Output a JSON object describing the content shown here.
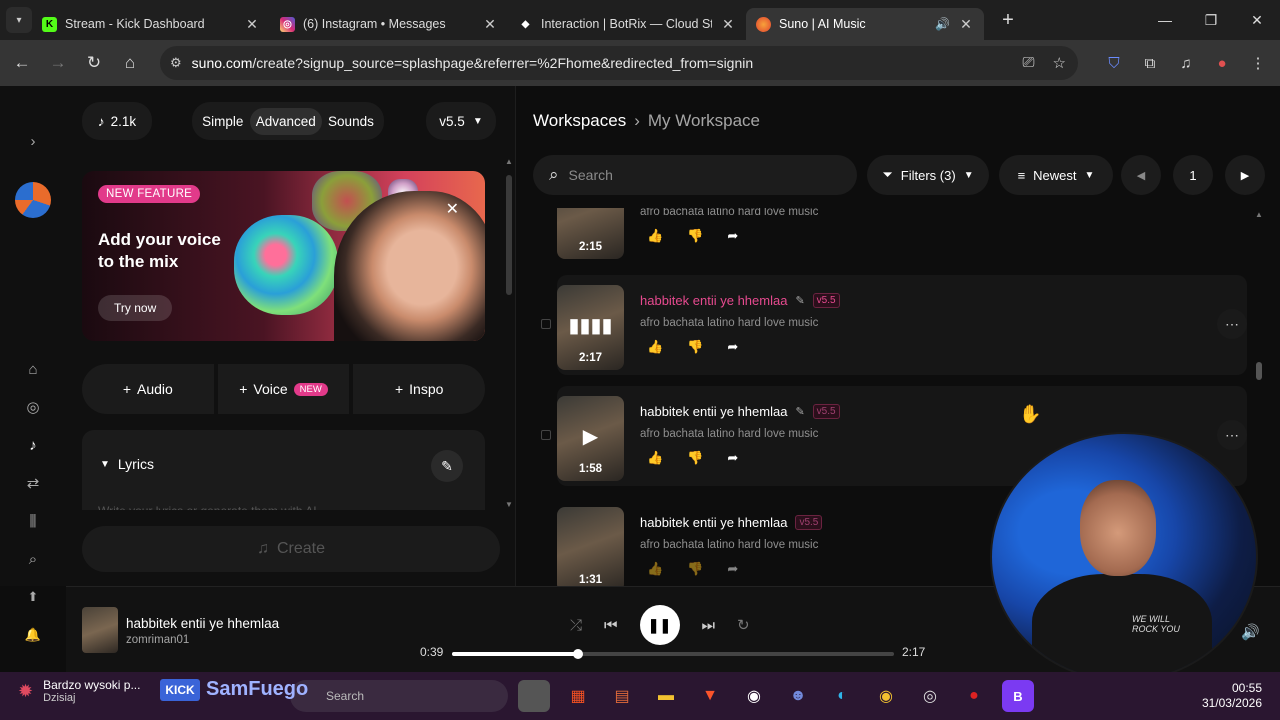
{
  "browser": {
    "tabs": [
      {
        "title": "Stream - Kick Dashboard",
        "icon": "kick-icon",
        "color": "#53fc18"
      },
      {
        "title": "(6) Instagram • Messages",
        "icon": "instagram-icon",
        "color": "#d62976"
      },
      {
        "title": "Interaction | BotRix — Cloud St",
        "icon": "botrix-icon",
        "color": "#ffffff"
      },
      {
        "title": "Suno | AI Music",
        "icon": "suno-icon",
        "color": "#f26c3a",
        "active": true
      }
    ],
    "url_host": "suno.com",
    "url_path": "/create?signup_source=splashpage&referrer=%2Fhome&redirected_from=signin"
  },
  "create": {
    "credits": "2.1k",
    "modes": [
      "Simple",
      "Advanced",
      "Sounds"
    ],
    "active_mode": "Advanced",
    "model": "v5.5",
    "promo": {
      "badge": "NEW FEATURE",
      "headline": "Add your voice to the mix",
      "cta": "Try now"
    },
    "add_buttons": {
      "audio": "Audio",
      "voice": "Voice",
      "voice_badge": "NEW",
      "inspo": "Inspo"
    },
    "lyrics_label": "Lyrics",
    "lyrics_placeholder": "Write your lyrics or generate them with AI",
    "create_label": "Create"
  },
  "workspace": {
    "breadcrumb_root": "Workspaces",
    "breadcrumb_current": "My Workspace",
    "search_placeholder": "Search",
    "filters_label": "Filters (3)",
    "sort_label": "Newest",
    "page": "1",
    "songs": [
      {
        "title": "",
        "tags": "afro bachata latino hard love music",
        "duration": "2:15",
        "version": ""
      },
      {
        "title": "habbitek entii ye hhemlaa",
        "tags": "afro bachata latino hard love music",
        "duration": "2:17",
        "version": "v5.5",
        "playing": true
      },
      {
        "title": "habbitek entii ye hhemlaa",
        "tags": "afro bachata latino hard love music",
        "duration": "1:58",
        "version": "v5.5"
      },
      {
        "title": "habbitek entii ye hhemlaa",
        "tags": "afro bachata latino hard love music",
        "duration": "1:31",
        "version": "v5.5"
      }
    ]
  },
  "player": {
    "title": "habbitek entii ye hhemlaa",
    "artist": "zomriman01",
    "elapsed": "0:39",
    "total": "2:17",
    "progress": 0.285
  },
  "webcam": {
    "shirt_text": "WE WILL ROCK YOU"
  },
  "taskbar": {
    "weather_title": "Bardzo wysoki p...",
    "weather_sub": "Dzisiaj",
    "overlay_name": "SamFuego",
    "overlay_logo": "KICK",
    "search_placeholder": "Search",
    "time": "00:55",
    "date": "31/03/2026"
  }
}
